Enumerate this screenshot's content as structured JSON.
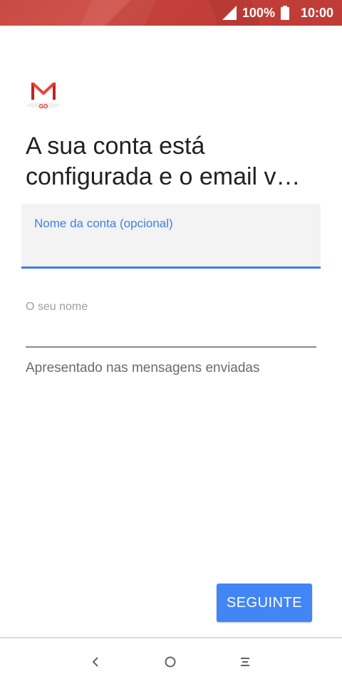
{
  "status_bar": {
    "battery_percent": "100%",
    "time": "10:00",
    "icons": [
      "signal-icon",
      "battery-icon"
    ],
    "color": "#c84540"
  },
  "app": {
    "logo_text": "GO",
    "logo_icon": "gmail-go-logo-icon"
  },
  "title": "A sua conta está configurada e o email v…",
  "account_field": {
    "label": "Nome da conta (opcional)",
    "value": ""
  },
  "name_field": {
    "label": "O seu nome",
    "value": "",
    "helper": "Apresentado nas mensagens enviadas"
  },
  "next_button": {
    "label": "SEGUINTE"
  },
  "nav_bar": {
    "icons": [
      "back-icon",
      "home-icon",
      "recents-icon"
    ]
  },
  "colors": {
    "accent": "#4285f4",
    "status_bar": "#c84540",
    "text_primary": "#202124",
    "text_secondary": "#6b6b6b"
  }
}
